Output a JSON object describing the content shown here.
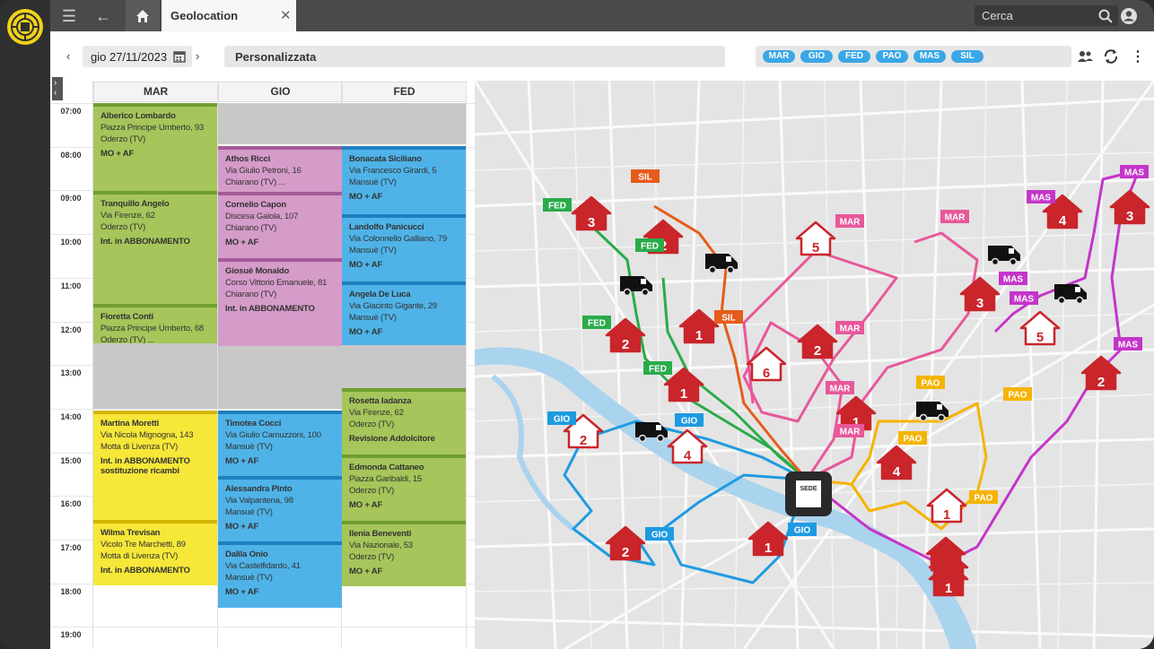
{
  "topbar": {
    "tab_title": "Geolocation",
    "search_placeholder": "Cerca"
  },
  "toolbar": {
    "date": "gio 27/11/2023",
    "view": "Personalizzata"
  },
  "chips": [
    "MAR",
    "GIO",
    "FED",
    "PAO",
    "MAS",
    "SIL"
  ],
  "calendar": {
    "columns": [
      "MAR",
      "GIO",
      "FED"
    ],
    "times": [
      "07:00",
      "08:00",
      "09:00",
      "10:00",
      "11:00",
      "12:00",
      "13:00",
      "14:00",
      "15:00",
      "16:00",
      "17:00",
      "18:00",
      "19:00"
    ],
    "events": [
      {
        "col": 0,
        "name": "Alberico Lombardo",
        "addr": "Piazza Principe Umberto, 93",
        "city": "Oderzo  (TV)",
        "tag": "MO + AF"
      },
      {
        "col": 0,
        "name": "Tranquillo Angelo",
        "addr": "Via Firenze, 62",
        "city": "Oderzo  (TV)",
        "tag": "Int. in ABBONAMENTO"
      },
      {
        "col": 0,
        "name": "Fioretta Conti",
        "addr": "Piazza Principe Umberto, 68",
        "city": "Oderzo  (TV) ...",
        "tag": ""
      },
      {
        "col": 0,
        "name": "Martina Moretti",
        "addr": "Via Nicola Mignogna, 143",
        "city": "Motta di Livenza (TV)",
        "tag": "Int. in ABBONAMENTO sostituzione ricambi"
      },
      {
        "col": 0,
        "name": "Wilma Trevisan",
        "addr": "Vicolo Tre Marchetti, 89",
        "city": "Motta di Livenza (TV)",
        "tag": "Int. in ABBONAMENTO"
      },
      {
        "col": 1,
        "name": "Athos Ricci",
        "addr": "Via Giulio Petroni, 16",
        "city": "Chiarano (TV) ...",
        "tag": ""
      },
      {
        "col": 1,
        "name": "Cornelio Capon",
        "addr": "Discesa Gaiola, 107",
        "city": "Chiarano (TV)",
        "tag": "MO + AF"
      },
      {
        "col": 1,
        "name": "Giosuè Monaldo",
        "addr": "Corso Vittorio Emanuele, 81",
        "city": "Chiarano (TV)",
        "tag": "Int. in ABBONAMENTO"
      },
      {
        "col": 1,
        "name": "Timotea Cocci",
        "addr": "Via Giulio Camuzzoni, 100",
        "city": "Mansuè (TV)",
        "tag": "MO + AF"
      },
      {
        "col": 1,
        "name": "Alessandra Pinto",
        "addr": "Via Valpantena, 98",
        "city": "Mansuè (TV)",
        "tag": "MO + AF"
      },
      {
        "col": 1,
        "name": "Dalila Onio",
        "addr": "Via Castelfidardo, 41",
        "city": "Mansuè (TV)",
        "tag": "MO + AF"
      },
      {
        "col": 2,
        "name": "Bonacata Siciliano",
        "addr": "Via Francesco Girardi, 5",
        "city": "Mansuè (TV)",
        "tag": "MO + AF"
      },
      {
        "col": 2,
        "name": "Landolfo Panicucci",
        "addr": "Via Colonnello Galliano, 79",
        "city": "Mansuè (TV)",
        "tag": "MO + AF"
      },
      {
        "col": 2,
        "name": "Angela De Luca",
        "addr": "Via Giacinto Gigante, 29",
        "city": "Mansuè (TV)",
        "tag": "MO + AF"
      },
      {
        "col": 2,
        "name": "Rosetta Iadanza",
        "addr": "Via Firenze, 62",
        "city": "Oderzo  (TV)",
        "tag": "Revisione Addolcitore"
      },
      {
        "col": 2,
        "name": "Edmonda Cattaneo",
        "addr": "Piazza Garibaldi, 15",
        "city": "Oderzo  (TV)",
        "tag": "MO + AF"
      },
      {
        "col": 2,
        "name": "Ilenia Beneventi",
        "addr": "Via Nazionale, 53",
        "city": "Oderzo  (TV)",
        "tag": "MO + AF"
      }
    ]
  },
  "map": {
    "hq_label": "SEDE",
    "colors": {
      "MAR": "#e8589a",
      "GIO": "#1e9be0",
      "FED": "#2aab4a",
      "PAO": "#f4b400",
      "MAS": "#c435c9",
      "SIL": "#e65c1a",
      "house": "#c9252b"
    },
    "labels": [
      {
        "text": "SIL",
        "color": "#e65c1a"
      },
      {
        "text": "FED",
        "color": "#2aab4a"
      },
      {
        "text": "FED",
        "color": "#2aab4a"
      },
      {
        "text": "FED",
        "color": "#2aab4a"
      },
      {
        "text": "FED",
        "color": "#2aab4a"
      },
      {
        "text": "SIL",
        "color": "#e65c1a"
      },
      {
        "text": "MAR",
        "color": "#e8589a"
      },
      {
        "text": "MAR",
        "color": "#e8589a"
      },
      {
        "text": "MAR",
        "color": "#e8589a"
      },
      {
        "text": "MAR",
        "color": "#e8589a"
      },
      {
        "text": "MAR",
        "color": "#e8589a"
      },
      {
        "text": "MAS",
        "color": "#c435c9"
      },
      {
        "text": "MAS",
        "color": "#c435c9"
      },
      {
        "text": "MAS",
        "color": "#c435c9"
      },
      {
        "text": "MAS",
        "color": "#c435c9"
      },
      {
        "text": "MAS",
        "color": "#c435c9"
      },
      {
        "text": "PAO",
        "color": "#f4b400"
      },
      {
        "text": "PAO",
        "color": "#f4b400"
      },
      {
        "text": "PAO",
        "color": "#f4b400"
      },
      {
        "text": "PAO",
        "color": "#f4b400"
      },
      {
        "text": "GIO",
        "color": "#1e9be0"
      },
      {
        "text": "GIO",
        "color": "#1e9be0"
      },
      {
        "text": "GIO",
        "color": "#1e9be0"
      },
      {
        "text": "GIO",
        "color": "#1e9be0"
      }
    ],
    "houses": [
      "3",
      "2",
      "2",
      "1",
      "1",
      "4",
      "2",
      "6",
      "5",
      "2",
      "1",
      "4",
      "1",
      "3",
      "4",
      "3",
      "5",
      "2",
      "1",
      "2",
      "1",
      "1",
      "1"
    ]
  }
}
